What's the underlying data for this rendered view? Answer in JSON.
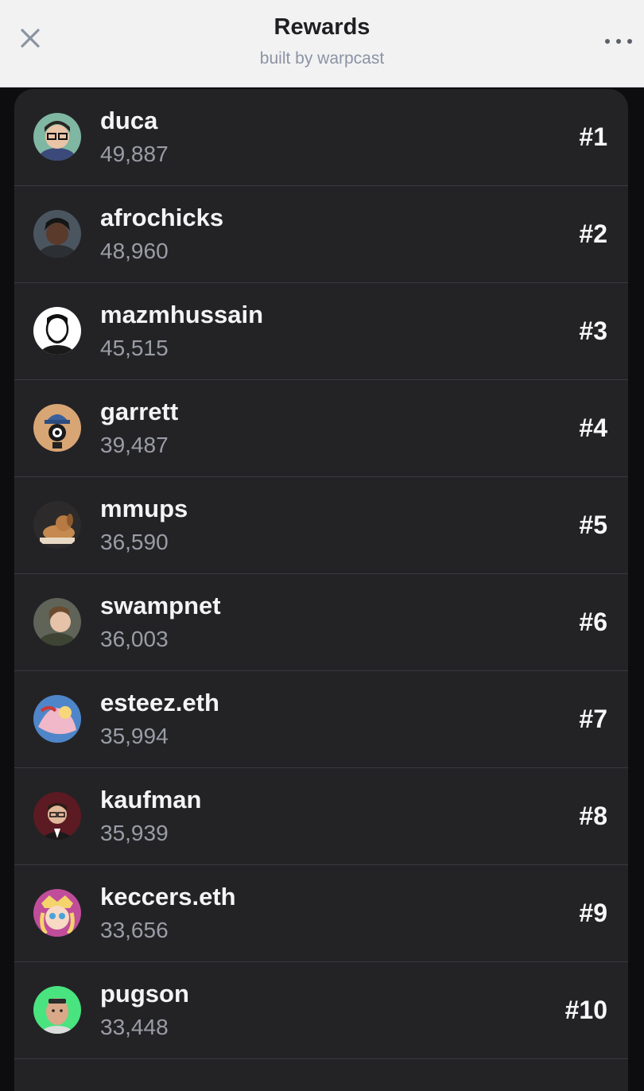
{
  "header": {
    "title": "Rewards",
    "subtitle": "built by warpcast",
    "close_icon": "close-icon",
    "more_icon": "more-options-icon"
  },
  "leaderboard": [
    {
      "username": "duca",
      "score": "49,887",
      "rank": "#1"
    },
    {
      "username": "afrochicks",
      "score": "48,960",
      "rank": "#2"
    },
    {
      "username": "mazmhussain",
      "score": "45,515",
      "rank": "#3"
    },
    {
      "username": "garrett",
      "score": "39,487",
      "rank": "#4"
    },
    {
      "username": "mmups",
      "score": "36,590",
      "rank": "#5"
    },
    {
      "username": "swampnet",
      "score": "36,003",
      "rank": "#6"
    },
    {
      "username": "esteez.eth",
      "score": "35,994",
      "rank": "#7"
    },
    {
      "username": "kaufman",
      "score": "35,939",
      "rank": "#8"
    },
    {
      "username": "keccers.eth",
      "score": "33,656",
      "rank": "#9"
    },
    {
      "username": "pugson",
      "score": "33,448",
      "rank": "#10"
    }
  ],
  "colors": {
    "header_bg": "#f2f2f3",
    "card_bg": "#232326",
    "text_primary": "#f4f4f6",
    "text_secondary": "#9a9ca6"
  }
}
